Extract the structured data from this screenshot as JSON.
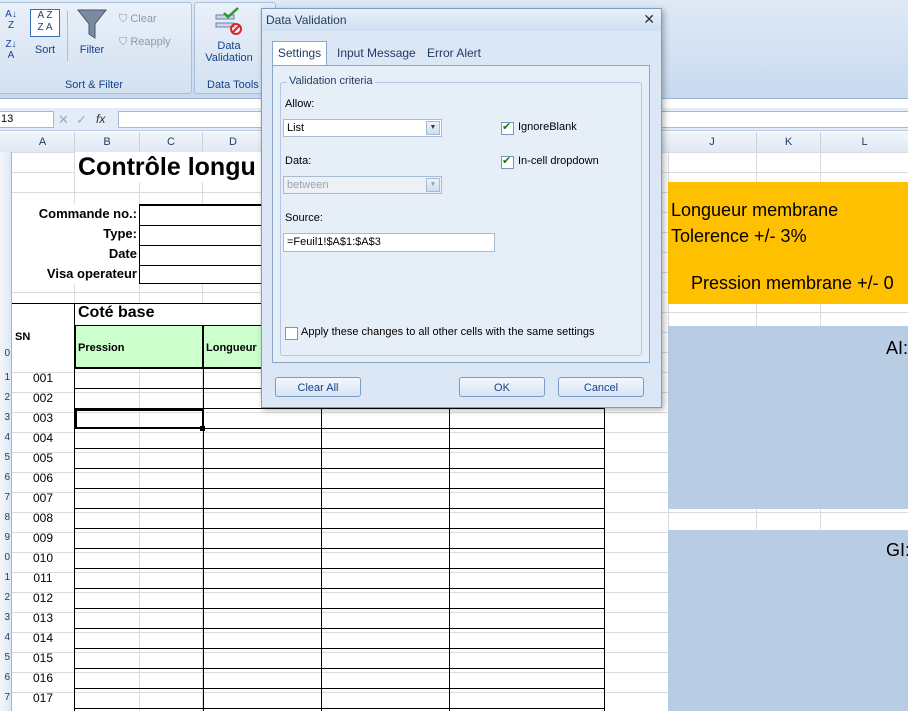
{
  "ribbon": {
    "sort_label": "Sort",
    "filter_label": "Filter",
    "clear_label": "Clear",
    "reapply_label": "Reapply",
    "sort_filter_group": "Sort & Filter",
    "data_validation_label_1": "Data",
    "data_validation_label_2": "Validation",
    "data_tools_group": "Data Tools"
  },
  "formula_bar": {
    "name_box": "13",
    "fx": "fx",
    "formula": ""
  },
  "columns": [
    "A",
    "B",
    "C",
    "D",
    "J",
    "K",
    "L"
  ],
  "rows": [
    "",
    "",
    "",
    "",
    "",
    "",
    "",
    "",
    "",
    "",
    "",
    "",
    "",
    "",
    "",
    "",
    "",
    "",
    "",
    "",
    "",
    "",
    "",
    "",
    "",
    "",
    "",
    ""
  ],
  "sheet": {
    "title": "Contrôle longu",
    "commande_label": "Commande no.:",
    "type_label": "Type:",
    "date_label": "Date",
    "visa_label": "Visa operateur",
    "sn_label": "SN",
    "cote_base": "Coté base",
    "pression_label": "Pression",
    "longueur_label": "Longueur",
    "serials": [
      "001",
      "002",
      "003",
      "004",
      "005",
      "006",
      "007",
      "008",
      "009",
      "010",
      "011",
      "012",
      "013",
      "014",
      "015",
      "016",
      "017"
    ],
    "row_numbers": [
      "0",
      "1",
      "2",
      "3",
      "4",
      "5",
      "6",
      "7",
      "8",
      "9",
      "0",
      "1",
      "2",
      "3",
      "4",
      "5",
      "6",
      "7"
    ],
    "note_line1": "Longueur membrane",
    "note_line2": "Tolerence +/- 3%",
    "note_line3": "Pression membrane +/- 0",
    "ais_label": "AI:",
    "gis_label": "GI:",
    "colors": {
      "orange": "#ffc000",
      "blue": "#b8cce4",
      "green": "#ccffcc"
    }
  },
  "dialog": {
    "title": "Data Validation",
    "tabs": [
      "Settings",
      "Input Message",
      "Error Alert"
    ],
    "group_title": "Validation criteria",
    "allow_label": "Allow:",
    "allow_value": "List",
    "ignore_blank": "IgnoreBlank",
    "in_cell_dropdown": "In-cell dropdown",
    "data_label": "Data:",
    "data_value": "between",
    "source_label": "Source:",
    "source_value": "=Feuil1!$A$1:$A$3",
    "apply_all": "Apply these changes to all other cells with the same settings",
    "clear_all": "Clear All",
    "ok": "OK",
    "cancel": "Cancel"
  }
}
